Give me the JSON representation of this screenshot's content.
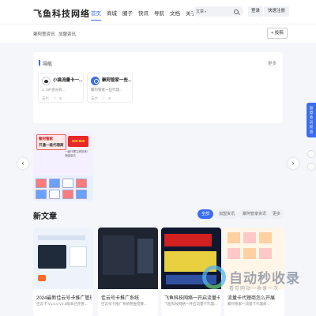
{
  "header": {
    "logo": "飞鱼科技网络",
    "nav": [
      "首页",
      "商城",
      "圈子",
      "快讯",
      "导航",
      "文档",
      "关于我们"
    ],
    "search": {
      "type": "文章",
      "placeholder": ""
    },
    "login": "登录",
    "submit": "快速注册"
  },
  "subbar": {
    "tabs": [
      "聚阿萱资讯",
      "加盟资讯"
    ],
    "plus_label": "+ 投稿"
  },
  "recommend": {
    "title": "导航",
    "more": "更多",
    "sites": [
      {
        "name": "小猫流量卡一...",
        "desc": "1. VIP会员有...",
        "views": "五六",
        "likes": "8"
      },
      {
        "name": "聚阿管家一些...",
        "desc": "聚阿管家一些代理...",
        "views": "五六",
        "likes": "8"
      }
    ]
  },
  "banner": {
    "head1": "聚阿管家",
    "head2": "开通一级代理商",
    "price": "200-800",
    "sub": "一级代理立即回本/佣金高达"
  },
  "articles": {
    "title": "新文章",
    "filters": [
      "全部",
      "加盟资讯",
      "聚阿管家资讯",
      "更多"
    ],
    "items": [
      {
        "title": "2024最新佳云号卡推广管理...",
        "desc": "佳云卡 V1.0.0 V2.0版本已完善..."
      },
      {
        "title": "佳云号卡推广系统",
        "desc": "佳云号卡推广系统佣金结算..."
      },
      {
        "title": "飞鱼科技网络一开启流量卡...",
        "desc": "飞鱼科技网络一开启流量卡代理..."
      },
      {
        "title": "流量卡代理商怎么开展",
        "desc": "聚阿管家一流量卡代理商..."
      }
    ]
  },
  "side": {
    "label": "加盟会员权益"
  },
  "watermark": {
    "text1": "自动秒收录",
    "text2": "看见网站一收录一次"
  }
}
